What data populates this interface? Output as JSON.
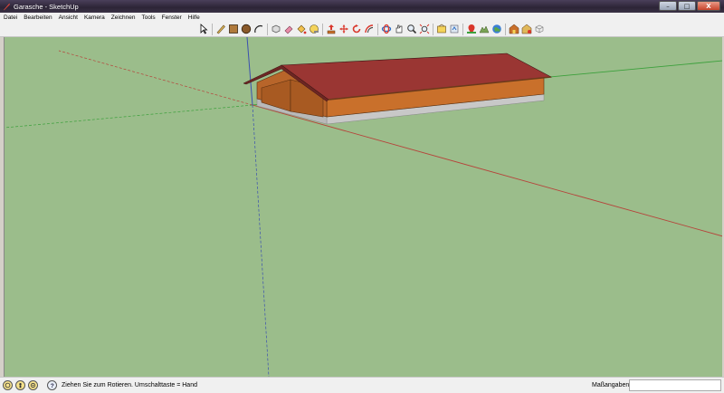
{
  "window": {
    "title": "Garasche - SketchUp",
    "controls": [
      "–",
      "□",
      "X"
    ]
  },
  "menu": [
    "Datei",
    "Bearbeiten",
    "Ansicht",
    "Kamera",
    "Zeichnen",
    "Tools",
    "Fenster",
    "Hilfe"
  ],
  "toolbar": {
    "tools": [
      "select-arrow-icon",
      "pencil-line-icon",
      "rectangle-icon",
      "circle-icon",
      "arc-icon",
      "make-component-icon",
      "eraser-icon",
      "paint-bucket-icon",
      "tape-measure-icon",
      "push-pull-icon",
      "move-icon",
      "rotate-icon",
      "offset-icon",
      "orbit-icon",
      "pan-icon",
      "zoom-icon",
      "zoom-extents-icon",
      "get-models-icon",
      "share-model-icon",
      "add-location-icon",
      "toggle-terrain-icon",
      "google-earth-icon",
      "warehouse-icon",
      "share-component-icon",
      "extension-icon"
    ]
  },
  "colors": {
    "ground": "#9bbd8b",
    "roof": "#9a3633",
    "wall": "#c9702b",
    "foundation": "#c8c8c8",
    "axis_red": "#b6443b",
    "axis_green": "#3ca03c",
    "axis_blue": "#3a4fb0"
  },
  "status": {
    "icons": [
      "geo-location-icon",
      "credits-icon",
      "user-icon",
      "help-icon"
    ],
    "hint": "Ziehen Sie zum Rotieren.  Umschalttaste = Hand",
    "measurements_label": "Maßangaben",
    "measurements_value": ""
  }
}
